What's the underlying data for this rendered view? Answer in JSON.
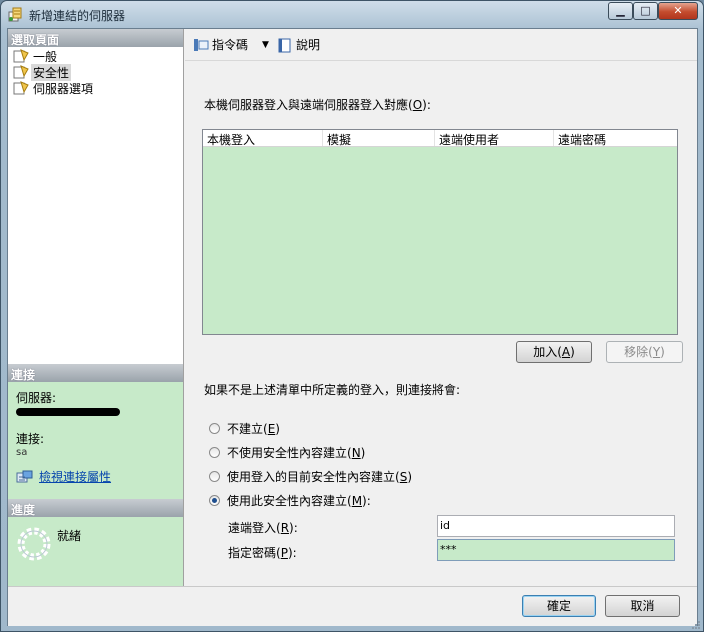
{
  "window": {
    "title": "新增連結的伺服器",
    "minimize_glyph": "▁",
    "maximize_glyph": "□",
    "close_glyph": "✕"
  },
  "left_panel": {
    "select_page_header": "選取頁面",
    "pages": [
      {
        "label": "一般",
        "icon": "page-icon"
      },
      {
        "label": "安全性",
        "icon": "page-icon",
        "selected": true
      },
      {
        "label": "伺服器選項",
        "icon": "page-icon"
      }
    ],
    "connection_header": "連接",
    "server_label": "伺服器:",
    "connection_label": "連接:",
    "connection_value": "sa",
    "view_connection_properties": "檢視連接屬性",
    "progress_header": "進度",
    "progress_status": "就緒"
  },
  "toolbar": {
    "script_label": "指令碼",
    "help_label": "說明"
  },
  "main": {
    "mapping_label": "本機伺服器登入與遠端伺服器登入對應(",
    "mapping_label_key": "O",
    "mapping_label_end": "):",
    "grid_columns": [
      "本機登入",
      "模擬",
      "遠端使用者",
      "遠端密碼"
    ],
    "add_button": {
      "text": "加入(",
      "key": "A",
      "end": ")"
    },
    "remove_button": {
      "text": "移除(",
      "key": "Y",
      "end": ")"
    },
    "not_defined_label": "如果不是上述清單中所定義的登入，則連接將會:",
    "options": [
      {
        "text": "不建立(",
        "key": "E",
        "end": ")",
        "checked": false
      },
      {
        "text": "不使用安全性內容建立(",
        "key": "N",
        "end": ")",
        "checked": false
      },
      {
        "text": "使用登入的目前安全性內容建立(",
        "key": "S",
        "end": ")",
        "checked": false
      },
      {
        "text": "使用此安全性內容建立(",
        "key": "M",
        "end": "):",
        "checked": true
      }
    ],
    "remote_login_label": {
      "text": "遠端登入(",
      "key": "R",
      "end": "):"
    },
    "remote_login_value": "id",
    "password_label": {
      "text": "指定密碼(",
      "key": "P",
      "end": "):"
    },
    "password_value": "***"
  },
  "footer": {
    "ok_label": "確定",
    "cancel_label": "取消"
  },
  "colors": {
    "panel_green": "#c7eac9",
    "link_blue": "#0645ad"
  }
}
